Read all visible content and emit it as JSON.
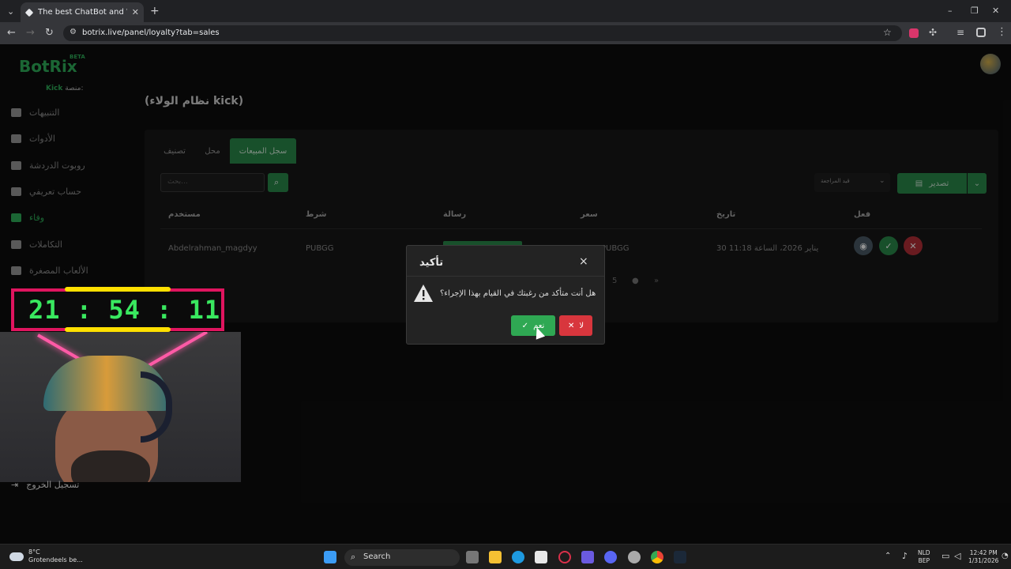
{
  "browser": {
    "tab_title": "The best ChatBot and Widgets",
    "url": "botrix.live/panel/loyalty?tab=sales"
  },
  "app": {
    "logo": "BotRix",
    "beta": "BETA",
    "platform_label": "منصة:",
    "platform_value": "Kick"
  },
  "sidebar": {
    "items": [
      {
        "label": "التنبيهات",
        "icon": "warning-icon"
      },
      {
        "label": "الأدوات",
        "icon": "tools-icon"
      },
      {
        "label": "روبوت الدردشة",
        "icon": "robot-icon"
      },
      {
        "label": "حساب تعريفي",
        "icon": "id-card-icon"
      },
      {
        "label": "وفاء",
        "icon": "trophy-icon"
      },
      {
        "label": "التكاملات",
        "icon": "integrations-icon"
      },
      {
        "label": "الألعاب المصغرة",
        "icon": "gamepad-icon"
      }
    ],
    "logout": "تسجيل الخروج"
  },
  "page_title": "(نظام الولاء kick)",
  "tabs": [
    "سجل المبيعات",
    "محل",
    "تصنيف"
  ],
  "search_placeholder": "بحث...",
  "sort_label": "قيد المراجعة",
  "export_label": "تصدير",
  "table": {
    "headers": [
      "مستخدم",
      "شرط",
      "رسالة",
      "سعر",
      "تاريخ",
      "فعل"
    ],
    "row": {
      "user": "Abdelrahman_magdyy",
      "condition": "PUBGG",
      "price": "PUBGG",
      "date": "30 يناير 2026، الساعة 11:18"
    }
  },
  "pagination": {
    "page": "5",
    "next": "»"
  },
  "dialog": {
    "title": "تأكيد",
    "message": "هل أنت متأكد من رغبتك في القيام بهذا الإجراء؟",
    "yes": "نعم",
    "no": "لا",
    "close": "×"
  },
  "stream": {
    "timer": "21 : 54 : 11"
  },
  "taskbar": {
    "temp": "8°C",
    "weather": "Grotendeels be...",
    "search": "Search",
    "lang": "NLD",
    "layout": "BEP",
    "time": "12:42 PM",
    "date": "1/31/2026"
  },
  "colors": {
    "accent": "#2fb05a",
    "danger": "#d8363d",
    "timer": "#39e85f",
    "frame": "#e0155f"
  }
}
